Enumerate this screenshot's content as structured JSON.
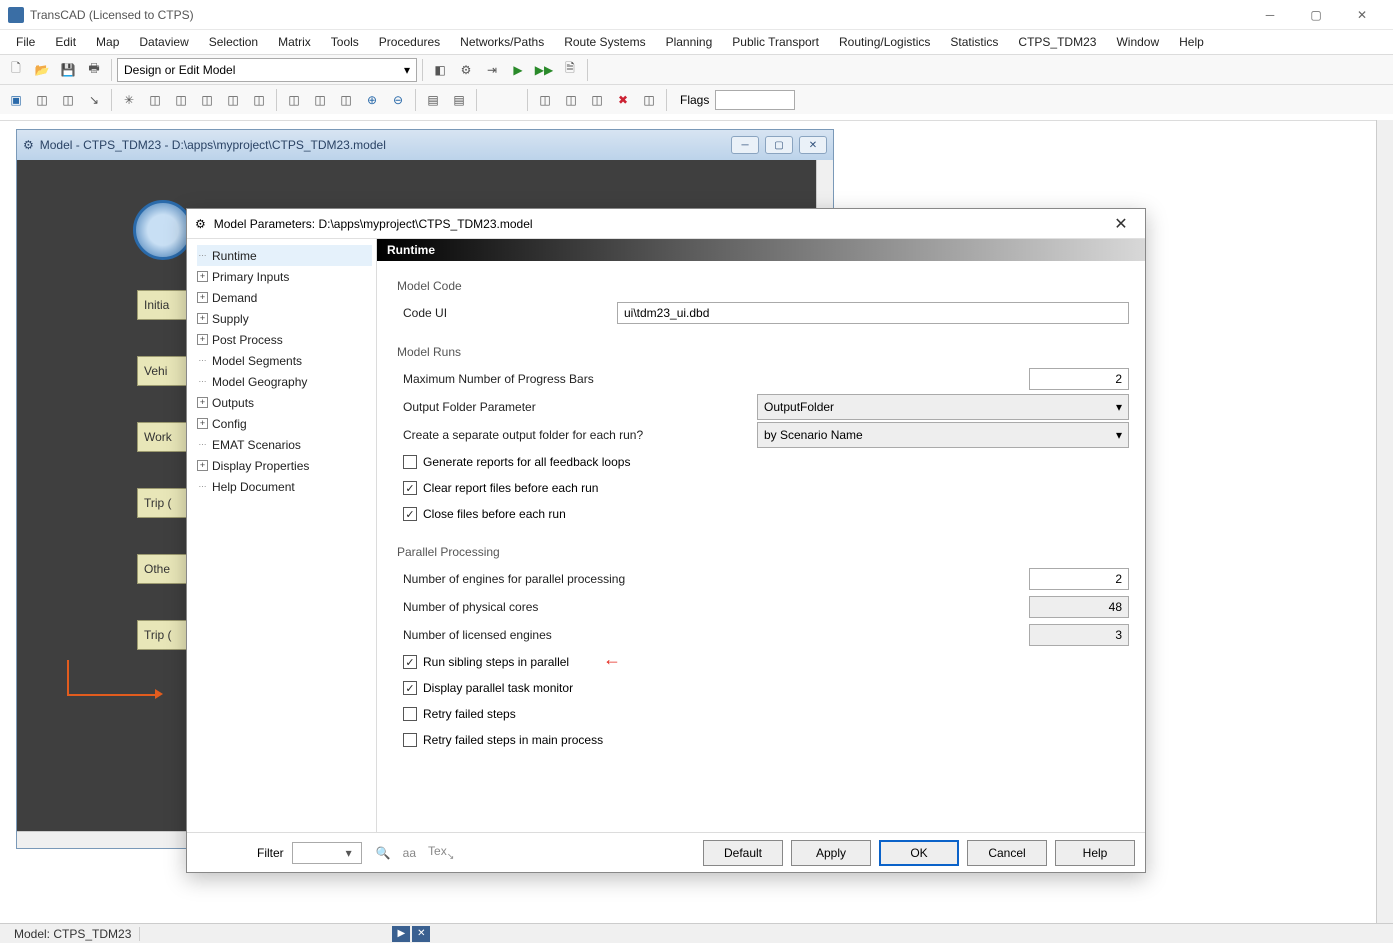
{
  "app": {
    "title": "TransCAD (Licensed to CTPS)"
  },
  "menu": [
    "File",
    "Edit",
    "Map",
    "Dataview",
    "Selection",
    "Matrix",
    "Tools",
    "Procedures",
    "Networks/Paths",
    "Route Systems",
    "Planning",
    "Public Transport",
    "Routing/Logistics",
    "Statistics",
    "CTPS_TDM23",
    "Window",
    "Help"
  ],
  "toolbar1": {
    "combo": "Design or Edit Model"
  },
  "toolbar2": {
    "flags_label": "Flags",
    "flags_value": ""
  },
  "mdi": {
    "title": "Model - CTPS_TDM23 - D:\\apps\\myproject\\CTPS_TDM23.model"
  },
  "flow": {
    "boxes": [
      "Initia",
      "Vehi",
      "Work",
      "Trip (",
      "Othe",
      "Trip ("
    ]
  },
  "dialog": {
    "title": "Model Parameters: D:\\apps\\myproject\\CTPS_TDM23.model",
    "tree": [
      {
        "label": "Runtime",
        "exp": "none",
        "selected": true
      },
      {
        "label": "Primary Inputs",
        "exp": "plus"
      },
      {
        "label": "Demand",
        "exp": "plus"
      },
      {
        "label": "Supply",
        "exp": "plus"
      },
      {
        "label": "Post Process",
        "exp": "plus"
      },
      {
        "label": "Model Segments",
        "exp": "none"
      },
      {
        "label": "Model Geography",
        "exp": "none"
      },
      {
        "label": "Outputs",
        "exp": "plus"
      },
      {
        "label": "Config",
        "exp": "plus"
      },
      {
        "label": "EMAT Scenarios",
        "exp": "none"
      },
      {
        "label": "Display Properties",
        "exp": "plus"
      },
      {
        "label": "Help Document",
        "exp": "none"
      }
    ],
    "section": "Runtime",
    "groups": {
      "model_code": {
        "label": "Model Code",
        "code_ui_label": "Code UI",
        "code_ui_value": "ui\\tdm23_ui.dbd"
      },
      "model_runs": {
        "label": "Model Runs",
        "max_bars_label": "Maximum Number of Progress Bars",
        "max_bars_value": "2",
        "out_folder_label": "Output Folder Parameter",
        "out_folder_value": "OutputFolder",
        "sep_folder_label": "Create a separate output folder for each run?",
        "sep_folder_value": "by Scenario Name",
        "chk_reports": "Generate reports for all feedback loops",
        "chk_clear": "Clear report files before each run",
        "chk_close": "Close files before each run"
      },
      "parallel": {
        "label": "Parallel Processing",
        "engines_label": "Number of engines for parallel processing",
        "engines_value": "2",
        "cores_label": "Number of physical cores",
        "cores_value": "48",
        "lic_label": "Number of licensed engines",
        "lic_value": "3",
        "chk_sibling": "Run sibling steps in parallel",
        "chk_monitor": "Display parallel task monitor",
        "chk_retry": "Retry failed steps",
        "chk_retry_main": "Retry failed steps in main process"
      }
    },
    "footer": {
      "filter_label": "Filter",
      "aa": "aa",
      "tex": "Tex",
      "buttons": {
        "default": "Default",
        "apply": "Apply",
        "ok": "OK",
        "cancel": "Cancel",
        "help": "Help"
      }
    }
  },
  "status": {
    "model": "Model: CTPS_TDM23"
  },
  "checks": {
    "reports": false,
    "clear": true,
    "close": true,
    "sibling": true,
    "monitor": true,
    "retry": false,
    "retry_main": false
  }
}
